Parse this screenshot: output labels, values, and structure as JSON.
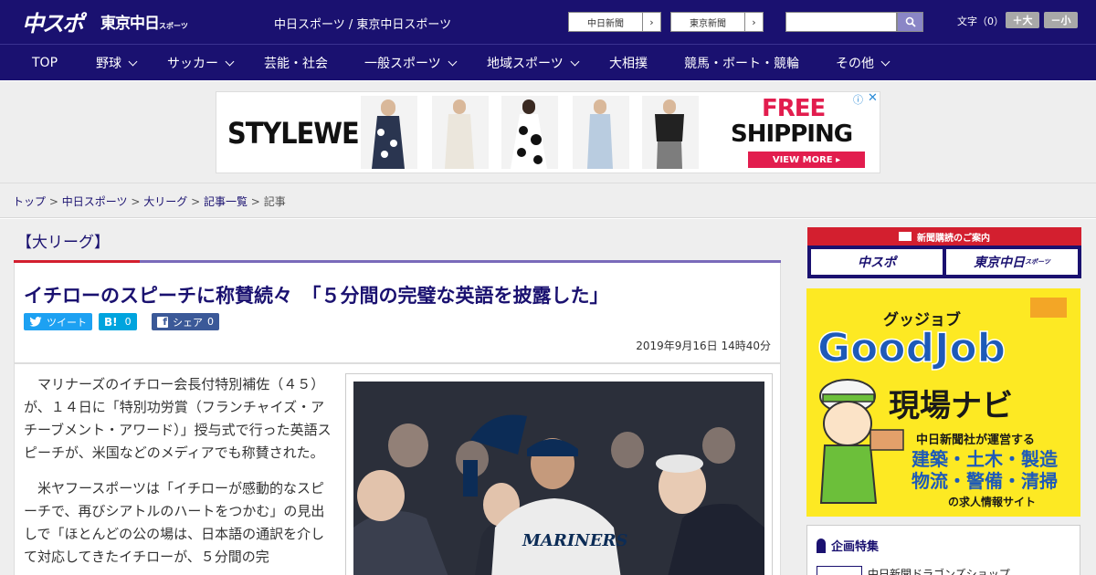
{
  "header": {
    "logo_main": "中スポ",
    "logo_tokyo": "東京中日",
    "logo_tokyo_small": "スポーツ",
    "site_title": "中日スポーツ / 東京中日スポーツ",
    "paper_links": [
      {
        "label": "中日新聞"
      },
      {
        "label": "東京新聞"
      }
    ],
    "search": {
      "placeholder": "",
      "value": ""
    },
    "font_size_label": "文字（0）",
    "font_larger": "＋大",
    "font_smaller": "－小"
  },
  "nav": {
    "items": [
      {
        "label": "TOP",
        "has_menu": false
      },
      {
        "label": "野球",
        "has_menu": true
      },
      {
        "label": "サッカー",
        "has_menu": true
      },
      {
        "label": "芸能・社会",
        "has_menu": false
      },
      {
        "label": "一般スポーツ",
        "has_menu": true
      },
      {
        "label": "地域スポーツ",
        "has_menu": true
      },
      {
        "label": "大相撲",
        "has_menu": false
      },
      {
        "label": "競馬・ボート・競輪",
        "has_menu": false
      },
      {
        "label": "その他",
        "has_menu": true
      }
    ]
  },
  "ad": {
    "brand": "STYLEWE",
    "headline_1": "FREE",
    "headline_2": "SHIPPING",
    "cta": "VIEW MORE ▸",
    "info_icon": "info-icon",
    "close_icon": "close-icon",
    "colors": {
      "accent": "#e21d4e"
    }
  },
  "breadcrumb": {
    "items": [
      "トップ",
      "中日スポーツ",
      "大リーグ",
      "記事一覧"
    ],
    "current": "記事",
    "separator": ">"
  },
  "article": {
    "category": "【大リーグ】",
    "title": "イチローのスピーチに称賛続々　「５分間の完璧な英語を披露した」",
    "share": {
      "tweet": "ツイート",
      "hatena_label": "B!",
      "hatena_count": "0",
      "facebook": "シェア",
      "facebook_count": "0"
    },
    "date": "2019年9月16日 14時40分",
    "paragraphs": [
      "マリナーズのイチロー会長付特別補佐（４５）が、１４日に「特別功労賞（フランチャイズ・アチーブメント・アワード）」授与式で行った英語スピーチが、米国などのメディアでも称賛された。",
      "米ヤフースポーツは「イチローが感動的なスピーチで、再びシアトルのハートをつかむ」の見出しで「ほとんどの公の場は、日本語の通訳を介して対応してきたイチローが、５分間の完"
    ],
    "photo_text": "MARINERS"
  },
  "sidebar": {
    "subscribe_head": "新聞購読のご案内",
    "subscribe_logo_1": "中スポ",
    "subscribe_logo_2": "東京中日",
    "subscribe_logo_2_small": "スポーツ",
    "goodjob": {
      "kana": "グッジョブ",
      "title": "GoodJob",
      "subtitle": "現場ナビ",
      "line1": "中日新聞社が運営する",
      "line2": "建築・土木・製造",
      "line3": "物流・警備・清掃",
      "line4": "の求人情報サイト"
    },
    "feature": {
      "title": "企画特集",
      "item": "中日新聞ドラゴンズショップ"
    }
  },
  "colors": {
    "brand_navy": "#1a1170",
    "accent_red": "#d31f2f",
    "twitter": "#1da1f2",
    "hatena": "#00a4de",
    "facebook": "#3b5998",
    "goodjob_yellow": "#fde923"
  }
}
